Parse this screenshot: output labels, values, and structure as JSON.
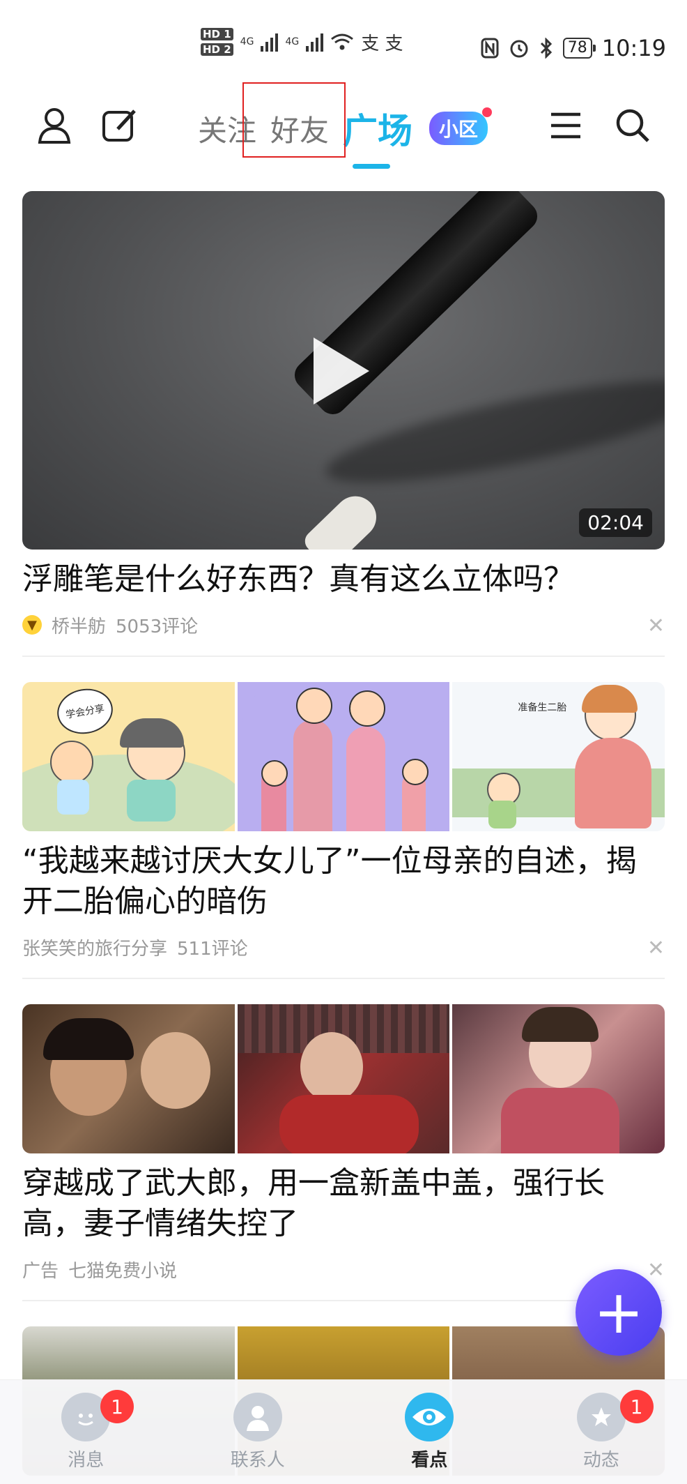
{
  "status_bar": {
    "hd1": "HD 1",
    "hd2": "HD 2",
    "net1": "4G",
    "net2": "4G",
    "extra": "支 支",
    "battery": "78",
    "time": "10:19"
  },
  "top_nav": {
    "tabs": [
      {
        "label": "关注"
      },
      {
        "label": "好友"
      },
      {
        "label": "广场"
      }
    ],
    "xiaoqu_label": "小区",
    "active_color": "#1cb4e8"
  },
  "feed": {
    "items": [
      {
        "title": "浮雕笔是什么好东西？真有这么立体吗？",
        "duration": "02:04",
        "author": "桥半舫",
        "comments": "5053评论"
      },
      {
        "title": "“我越来越讨厌大女儿了”一位母亲的自述，揭开二胎偏心的暗伤",
        "author": "张笑笑的旅行分享",
        "comments": "511评论",
        "thumb_labels": [
          "学会分享",
          "准备生二胎"
        ]
      },
      {
        "title": "穿越成了武大郎，用一盒新盖中盖，强行长高，妻子情绪失控了",
        "ad_label": "广告",
        "author": "七猫免费小说"
      }
    ]
  },
  "bottom_nav": {
    "items": [
      {
        "label": "消息",
        "badge": "1"
      },
      {
        "label": "联系人"
      },
      {
        "label": "看点"
      },
      {
        "label": "动态",
        "badge": "1"
      }
    ]
  }
}
